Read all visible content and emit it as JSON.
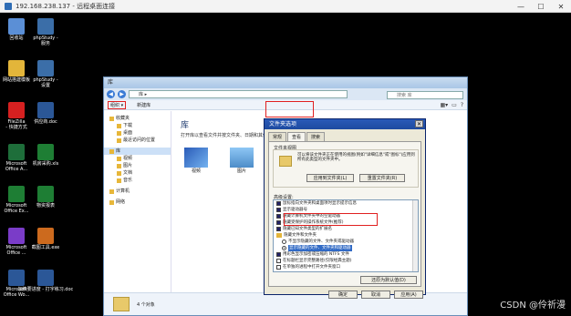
{
  "rdp": {
    "title": "192.168.238.137 - 远程桌面连接",
    "minimize": "—",
    "maximize": "☐",
    "close": "✕"
  },
  "desktop_icons": [
    {
      "label": "回收站",
      "color": "#5b8fd6"
    },
    {
      "label": "phpStudy -\n服务",
      "color": "#3b6ea8"
    },
    {
      "label": "网站搭建模板",
      "color": "#e3b53a"
    },
    {
      "label": "phpStudy -\n设置",
      "color": "#3b6ea8"
    },
    {
      "label": "FileZilla\n- 快捷方式",
      "color": "#d62020"
    },
    {
      "label": "供应商.doc",
      "color": "#2b5797"
    },
    {
      "label": "Microsoft\nOffice A...",
      "color": "#1e6e3a"
    },
    {
      "label": "机房采购.xls",
      "color": "#1e7e34"
    },
    {
      "label": "Microsoft\nOffice Ex...",
      "color": "#1e7e34"
    },
    {
      "label": "物资报表",
      "color": "#1e7e34"
    },
    {
      "label": "Microsoft\nOffice ...",
      "color": "#7a3cc8"
    },
    {
      "label": "截图工具.exe",
      "color": "#cc6a1e"
    },
    {
      "label": "Microsoft\nOffice Wo...",
      "color": "#2b5797"
    },
    {
      "label": "加快要进度 - 打字练习.doc",
      "color": "#2b5797"
    }
  ],
  "explorer": {
    "title": "库",
    "address": "库 ▸",
    "search_placeholder": "搜索 库",
    "toolbar": {
      "organize": "组织 ▾",
      "new_library": "新建库"
    },
    "nav": [
      {
        "label": "收藏夹",
        "level": 0
      },
      {
        "label": "下载",
        "level": 1
      },
      {
        "label": "桌面",
        "level": 1
      },
      {
        "label": "最近访问的位置",
        "level": 1
      },
      {
        "label": "库",
        "level": 0,
        "selected": true
      },
      {
        "label": "视频",
        "level": 1
      },
      {
        "label": "图片",
        "level": 1
      },
      {
        "label": "文档",
        "level": 1
      },
      {
        "label": "音乐",
        "level": 1
      },
      {
        "label": "计算机",
        "level": 0
      },
      {
        "label": "网络",
        "level": 0
      }
    ],
    "lib_title": "库",
    "lib_desc": "打开库以查看文件并按文件夹、日期和其他属性排列它们。",
    "items": [
      {
        "label": "视频"
      },
      {
        "label": "图片"
      }
    ],
    "status": "4 个对象"
  },
  "dialog": {
    "title": "文件夹选项",
    "close": "✕",
    "tabs": [
      "常规",
      "查看",
      "搜索"
    ],
    "active_tab": 1,
    "group_label": "文件夹视图",
    "group_text": "可以将该文件夹正在使用的视图(例如\"详细信息\"或\"图标\")应用到所有此类型的文件夹中。",
    "apply_btn": "应用到文件夹(L)",
    "reset_btn": "重置文件夹(R)",
    "adv_label": "高级设置:",
    "adv_rows": [
      {
        "type": "chk",
        "on": true,
        "label": "鼠标指向文件夹和桌面项时显示提示信息"
      },
      {
        "type": "chk",
        "on": true,
        "label": "显示驱动器号"
      },
      {
        "type": "chk",
        "on": true,
        "label": "隐藏计算机文件夹中的空驱动器"
      },
      {
        "type": "chk",
        "on": true,
        "label": "隐藏受保护的操作系统文件(推荐)"
      },
      {
        "type": "chk",
        "on": true,
        "label": "隐藏已知文件类型的扩展名"
      },
      {
        "type": "folder",
        "on": false,
        "label": "隐藏文件和文件夹"
      },
      {
        "type": "rad",
        "on": false,
        "label": "不显示隐藏的文件、文件夹或驱动器",
        "indent": true
      },
      {
        "type": "rad",
        "on": true,
        "label": "显示隐藏的文件、文件夹和驱动器",
        "indent": true,
        "selected": true
      },
      {
        "type": "chk",
        "on": true,
        "label": "用彩色显示加密或压缩的 NTFS 文件"
      },
      {
        "type": "chk",
        "on": false,
        "label": "在标题栏显示完整路径(仅限经典主题)"
      },
      {
        "type": "chk",
        "on": false,
        "label": "在单独的进程中打开文件夹窗口"
      }
    ],
    "restore_btn": "还原为默认值(D)",
    "ok": "确定",
    "cancel": "取消",
    "apply": "应用(A)"
  },
  "watermark": "CSDN @伶祈漫"
}
